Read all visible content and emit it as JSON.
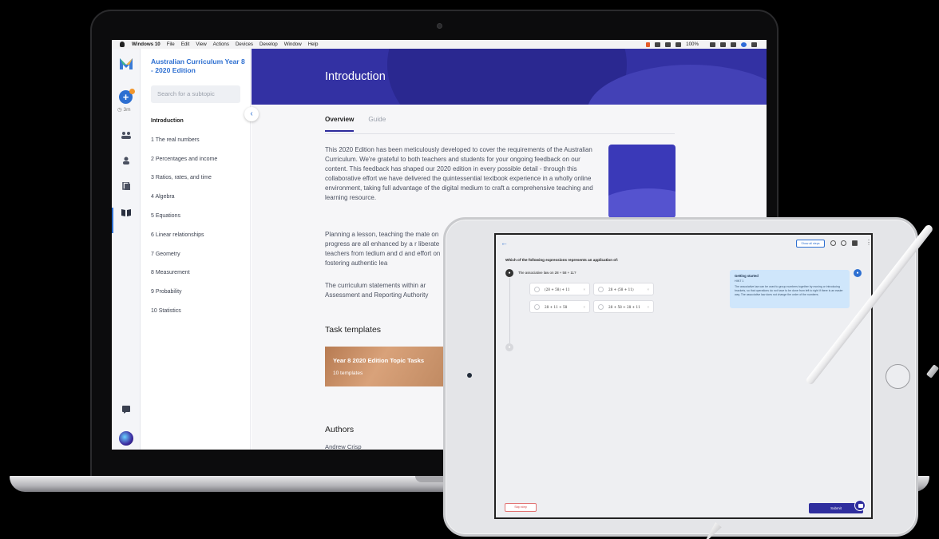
{
  "menubar": {
    "items": [
      "Windows 10",
      "File",
      "Edit",
      "View",
      "Actions",
      "Devices",
      "Develop",
      "Window",
      "Help"
    ],
    "status": "100%"
  },
  "rail": {
    "timer": "3m"
  },
  "sidebar": {
    "title": "Australian Curriculum Year 8 - 2020 Edition",
    "search_placeholder": "Search for a subtopic",
    "items": [
      "Introduction",
      "1 The real numbers",
      "2 Percentages and income",
      "3 Ratios, rates, and time",
      "4 Algebra",
      "5 Equations",
      "6 Linear relationships",
      "7 Geometry",
      "8 Measurement",
      "9 Probability",
      "10 Statistics"
    ]
  },
  "main": {
    "title": "Introduction",
    "tabs": [
      "Overview",
      "Guide"
    ],
    "paragraphs": [
      "This 2020 Edition has been meticulously developed to cover the requirements of the Australian Curriculum. We're grateful to both teachers and students for your ongoing feedback on our content.  This feedback has shaped our 2020 edition in every possible detail - through this collaborative effort we have delivered the quintessential textbook experience in a wholly online environment, taking full advantage of the digital medium to craft a comprehensive teaching and learning resource.",
      "Planning a lesson, teaching the mate on progress are all enhanced by a r liberate teachers from tedium and d and effort on fostering authentic lea",
      "The curriculum statements within ar Assessment and Reporting Authority"
    ],
    "task_templates_heading": "Task templates",
    "task_card_title": "Year 8 2020 Edition Topic Tasks",
    "task_card_sub": "10 templates",
    "authors_heading": "Authors",
    "author_name": "Andrew Crisp"
  },
  "tablet": {
    "show_steps": "Show all steps",
    "question": "Which of the following expressions represents an application of:",
    "statement": "The associative law on 28 + 58 + 11?",
    "options": [
      "(28 + 58) + 11",
      "28 + (58 + 11)",
      "28 + 11 + 58",
      "28 + 58 + 28 + 11"
    ],
    "hint_title": "Getting started",
    "hint_sub": "HINT 1",
    "hint_body": "The associative law can be used to group numbers together by moving or introducing brackets, so that operations do not have to be done from left to right if there is an easier way. The associative law does not change the order of the numbers.",
    "skip": "Skip step",
    "submit": "Submit"
  },
  "colors": {
    "accent": "#2d6fd1",
    "hero": "#3331a3",
    "submit": "#2f2e9e"
  }
}
